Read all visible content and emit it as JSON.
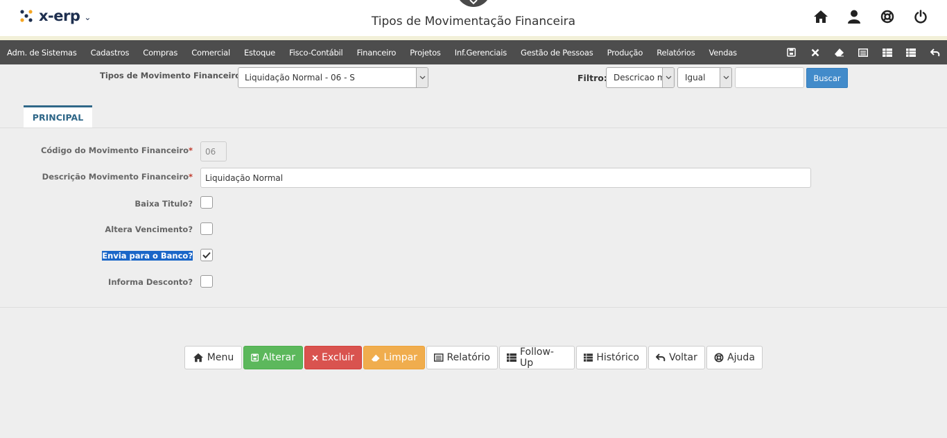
{
  "header": {
    "logo_text": "x-erp",
    "page_title": "Tipos de Movimentação Financeira",
    "icons": [
      "home-icon",
      "user-icon",
      "support-icon",
      "power-icon"
    ]
  },
  "menu": {
    "items": [
      "Adm. de Sistemas",
      "Cadastros",
      "Compras",
      "Comercial",
      "Estoque",
      "Fisco-Contábil",
      "Financeiro",
      "Projetos",
      "Inf.Gerenciais",
      "Gestão de Pessoas",
      "Produção",
      "Relatórios",
      "Vendas"
    ],
    "tools": [
      "save-icon",
      "close-icon",
      "eraser-icon",
      "report-icon",
      "table-icon",
      "table-list-icon",
      "undo-icon"
    ]
  },
  "selector": {
    "label": "Tipos de Movimento Financeiro",
    "value": "Liquidação Normal - 06 - S"
  },
  "filter": {
    "label": "Filtro:",
    "field": "Descricao mov",
    "operator": "Igual",
    "value": "",
    "search_label": "Buscar"
  },
  "tabs": [
    "PRINCIPAL"
  ],
  "form": {
    "codigo_label": "Código do Movimento Financeiro",
    "codigo_value": "06",
    "descricao_label": "Descrição Movimento Financeiro",
    "descricao_value": "Liquidação Normal",
    "required_mark": "*",
    "checks": [
      {
        "label": "Baixa Titulo?",
        "checked": false
      },
      {
        "label": "Altera Vencimento?",
        "checked": false
      },
      {
        "label": "Envia para o Banco?",
        "checked": true
      },
      {
        "label": "Informa Desconto?",
        "checked": false
      }
    ]
  },
  "actions": {
    "menu": "Menu",
    "alterar": "Alterar",
    "excluir": "Excluir",
    "limpar": "Limpar",
    "relatorio": "Relatório",
    "followup": "Follow-Up",
    "historico": "Histórico",
    "voltar": "Voltar",
    "ajuda": "Ajuda"
  },
  "colors": {
    "menubar": "#4d4d4d",
    "primary": "#428bca",
    "success": "#5cb85c",
    "danger": "#d9534f",
    "warning": "#f0ad4e",
    "tab_accent": "#2f6788"
  }
}
